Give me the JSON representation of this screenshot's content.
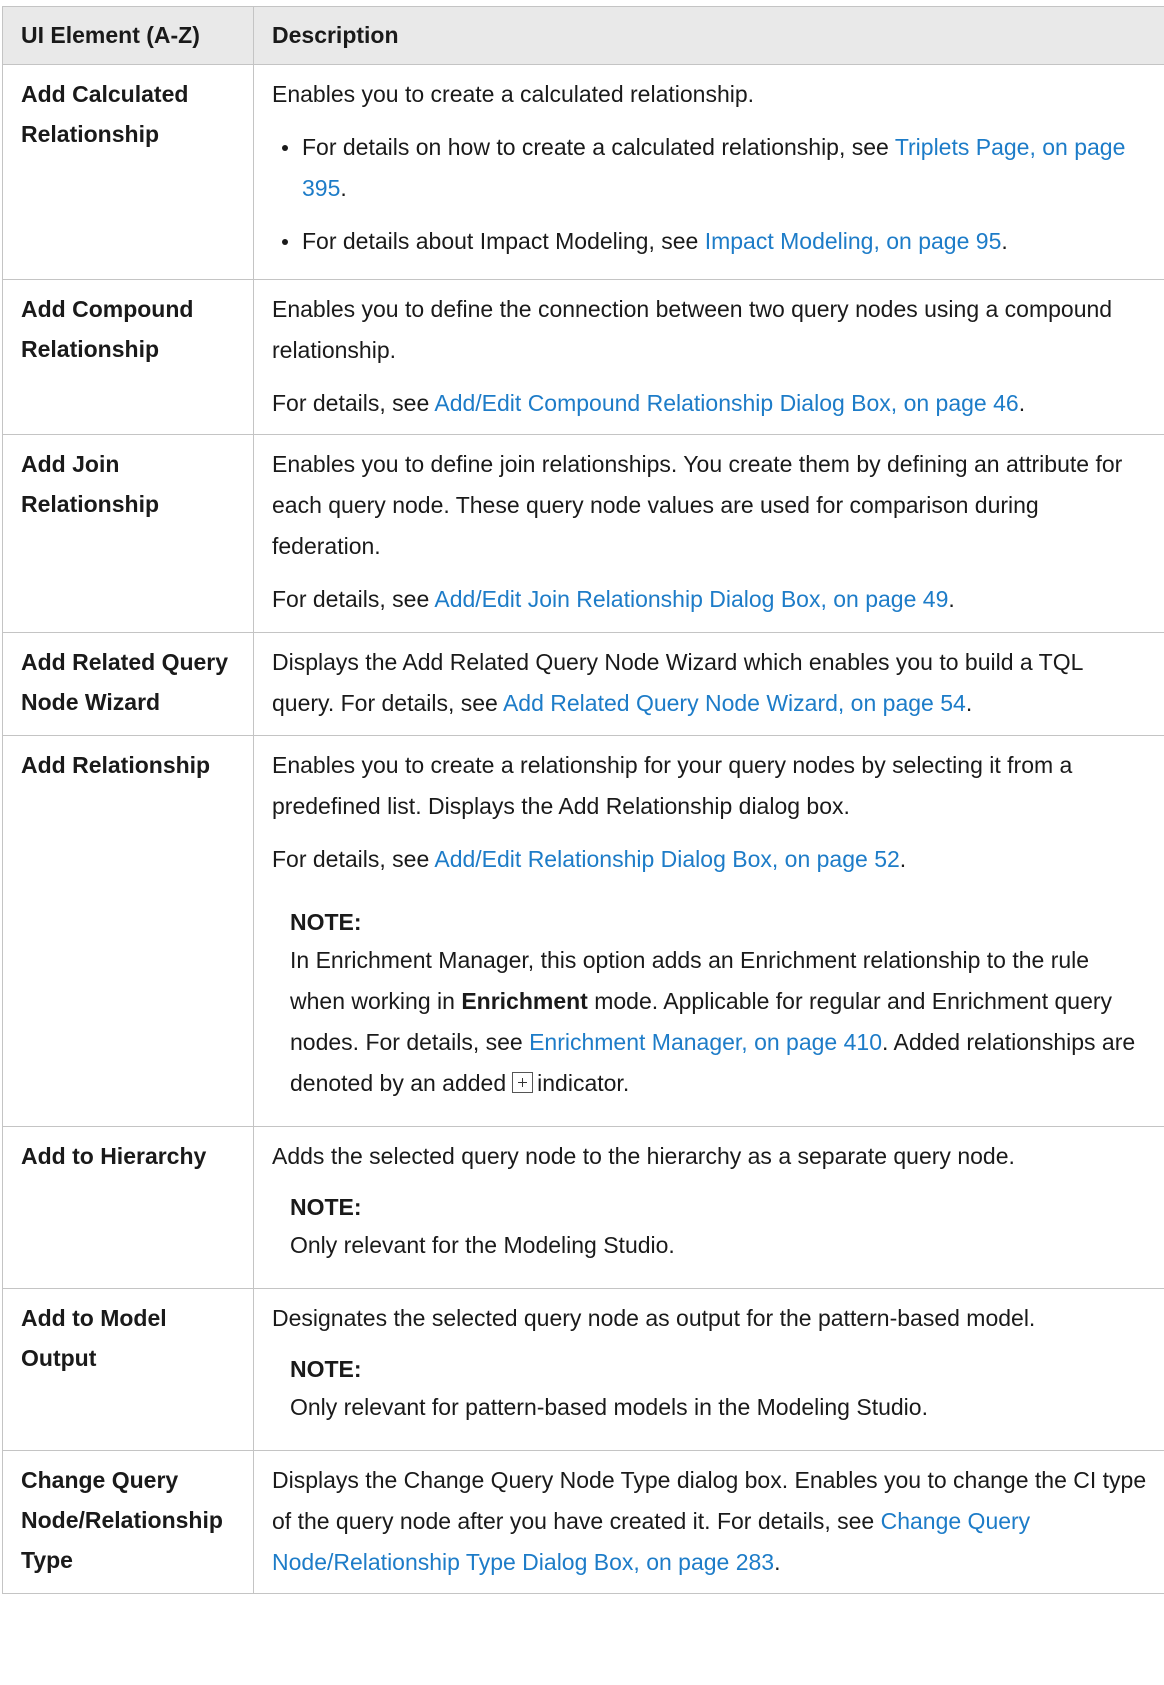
{
  "header": {
    "col1": "UI Element (A-Z)",
    "col2": "Description"
  },
  "rows": [
    {
      "name_line1": "Add Calculated",
      "name_line2": "Relationship",
      "intro": "Enables you to create a calculated relationship.",
      "bullet1_text": "For details on how to create a calculated relationship, see ",
      "bullet1_link": "Triplets Page, on page 395",
      "bullet2_text": "For details about Impact Modeling, see ",
      "bullet2_link": "Impact Modeling, on page 95"
    },
    {
      "name_line1": "Add Compound",
      "name_line2": "Relationship",
      "intro": "Enables you to define the connection between two query nodes using a compound relationship.",
      "details_prefix": "For details, see ",
      "details_link": "Add/Edit Compound Relationship Dialog Box, on page 46"
    },
    {
      "name_line1": "Add Join",
      "name_line2": "Relationship",
      "intro": "Enables you to define join relationships. You create them by defining an attribute for each query node. These query node values are used for comparison during federation.",
      "details_prefix": "For details, see ",
      "details_link": "Add/Edit Join Relationship Dialog Box, on page 49"
    },
    {
      "name_line1": "Add Related Query",
      "name_line2": "Node Wizard",
      "intro": "Displays the Add Related Query Node Wizard which enables you to build a TQL query. For details, see ",
      "details_link": "Add Related Query Node Wizard, on page 54"
    },
    {
      "name_line1": "Add Relationship",
      "intro": "Enables you to create a relationship for your query nodes by selecting it from a predefined list. Displays the Add Relationship dialog box.",
      "details_prefix": "For details, see ",
      "details_link": "Add/Edit Relationship Dialog Box, on page 52",
      "note_title": "NOTE:",
      "note_text1": "In Enrichment Manager, this option adds an Enrichment relationship to the rule when working in ",
      "note_bold": "Enrichment",
      "note_text2": " mode. Applicable for regular and Enrichment query nodes. For details, see ",
      "note_link": "Enrichment Manager, on page 410",
      "note_text3": ". Added relationships are denoted by an added",
      "note_text4": "indicator.",
      "note_icon": "added-indicator-icon"
    },
    {
      "name_line1": "Add to Hierarchy",
      "intro": "Adds the selected query node to the hierarchy as a separate query node.",
      "note_title": "NOTE:",
      "note_text": "Only relevant for the Modeling Studio."
    },
    {
      "name_line1": "Add to Model",
      "name_line2": "Output",
      "intro": "Designates the selected query node as output for the pattern-based model.",
      "note_title": "NOTE:",
      "note_text": "Only relevant for pattern-based models in the Modeling Studio."
    },
    {
      "name_line1": "Change Query",
      "name_line2": "Node/Relationship",
      "name_line3": "Type",
      "intro": "Displays the Change Query Node Type dialog box. Enables you to change the CI type of the query node after you have created it. For details, see ",
      "details_link": "Change Query Node/Relationship Type Dialog Box, on page 283"
    }
  ],
  "colors": {
    "link": "#1d7cc8",
    "header_bg": "#e9e9e9",
    "border": "#c4c4c4"
  }
}
